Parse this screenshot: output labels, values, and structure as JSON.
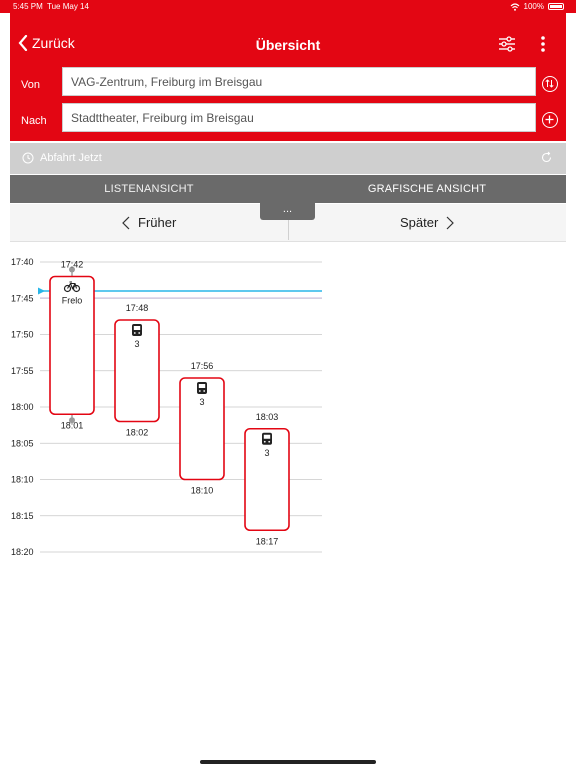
{
  "status_bar": {
    "time": "5:45 PM",
    "date": "Tue May 14",
    "battery": "100%"
  },
  "nav": {
    "back_label": "Zurück",
    "title": "Übersicht"
  },
  "search": {
    "from_label": "Von",
    "from_value": "VAG-Zentrum, Freiburg im Breisgau",
    "to_label": "Nach",
    "to_value": "Stadttheater, Freiburg im Breisgau"
  },
  "departure": {
    "label": "Abfahrt Jetzt"
  },
  "tabs": [
    {
      "label": "LISTENANSICHT"
    },
    {
      "label": "GRAFISCHE ANSICHT"
    }
  ],
  "pager": {
    "earlier_label": "Früher",
    "later_label": "Später",
    "handle_label": "..."
  },
  "timeline": {
    "ticks": [
      "17:40",
      "17:45",
      "17:50",
      "17:55",
      "18:00",
      "18:05",
      "18:10",
      "18:15",
      "18:20"
    ],
    "start_minutes": 1060,
    "current_time_minutes": 1064,
    "now_line_color": "#29b6e8",
    "trips": [
      {
        "icon": "bicycle-icon",
        "label": "Frelo",
        "depart": "17:42",
        "arrive": "18:01",
        "depart_min": 1062,
        "arrive_min": 1081,
        "walk": true
      },
      {
        "icon": "tram-icon",
        "label": "3",
        "depart": "17:48",
        "arrive": "18:02",
        "depart_min": 1068,
        "arrive_min": 1082,
        "walk": false
      },
      {
        "icon": "tram-icon",
        "label": "3",
        "depart": "17:56",
        "arrive": "18:10",
        "depart_min": 1076,
        "arrive_min": 1090,
        "walk": false
      },
      {
        "icon": "tram-icon",
        "label": "3",
        "depart": "18:03",
        "arrive": "18:17",
        "depart_min": 1083,
        "arrive_min": 1097,
        "walk": false
      }
    ]
  },
  "colors": {
    "brand_red": "#e30613",
    "tab_gray": "#6a6a6a",
    "trip_border": "#e30613"
  }
}
